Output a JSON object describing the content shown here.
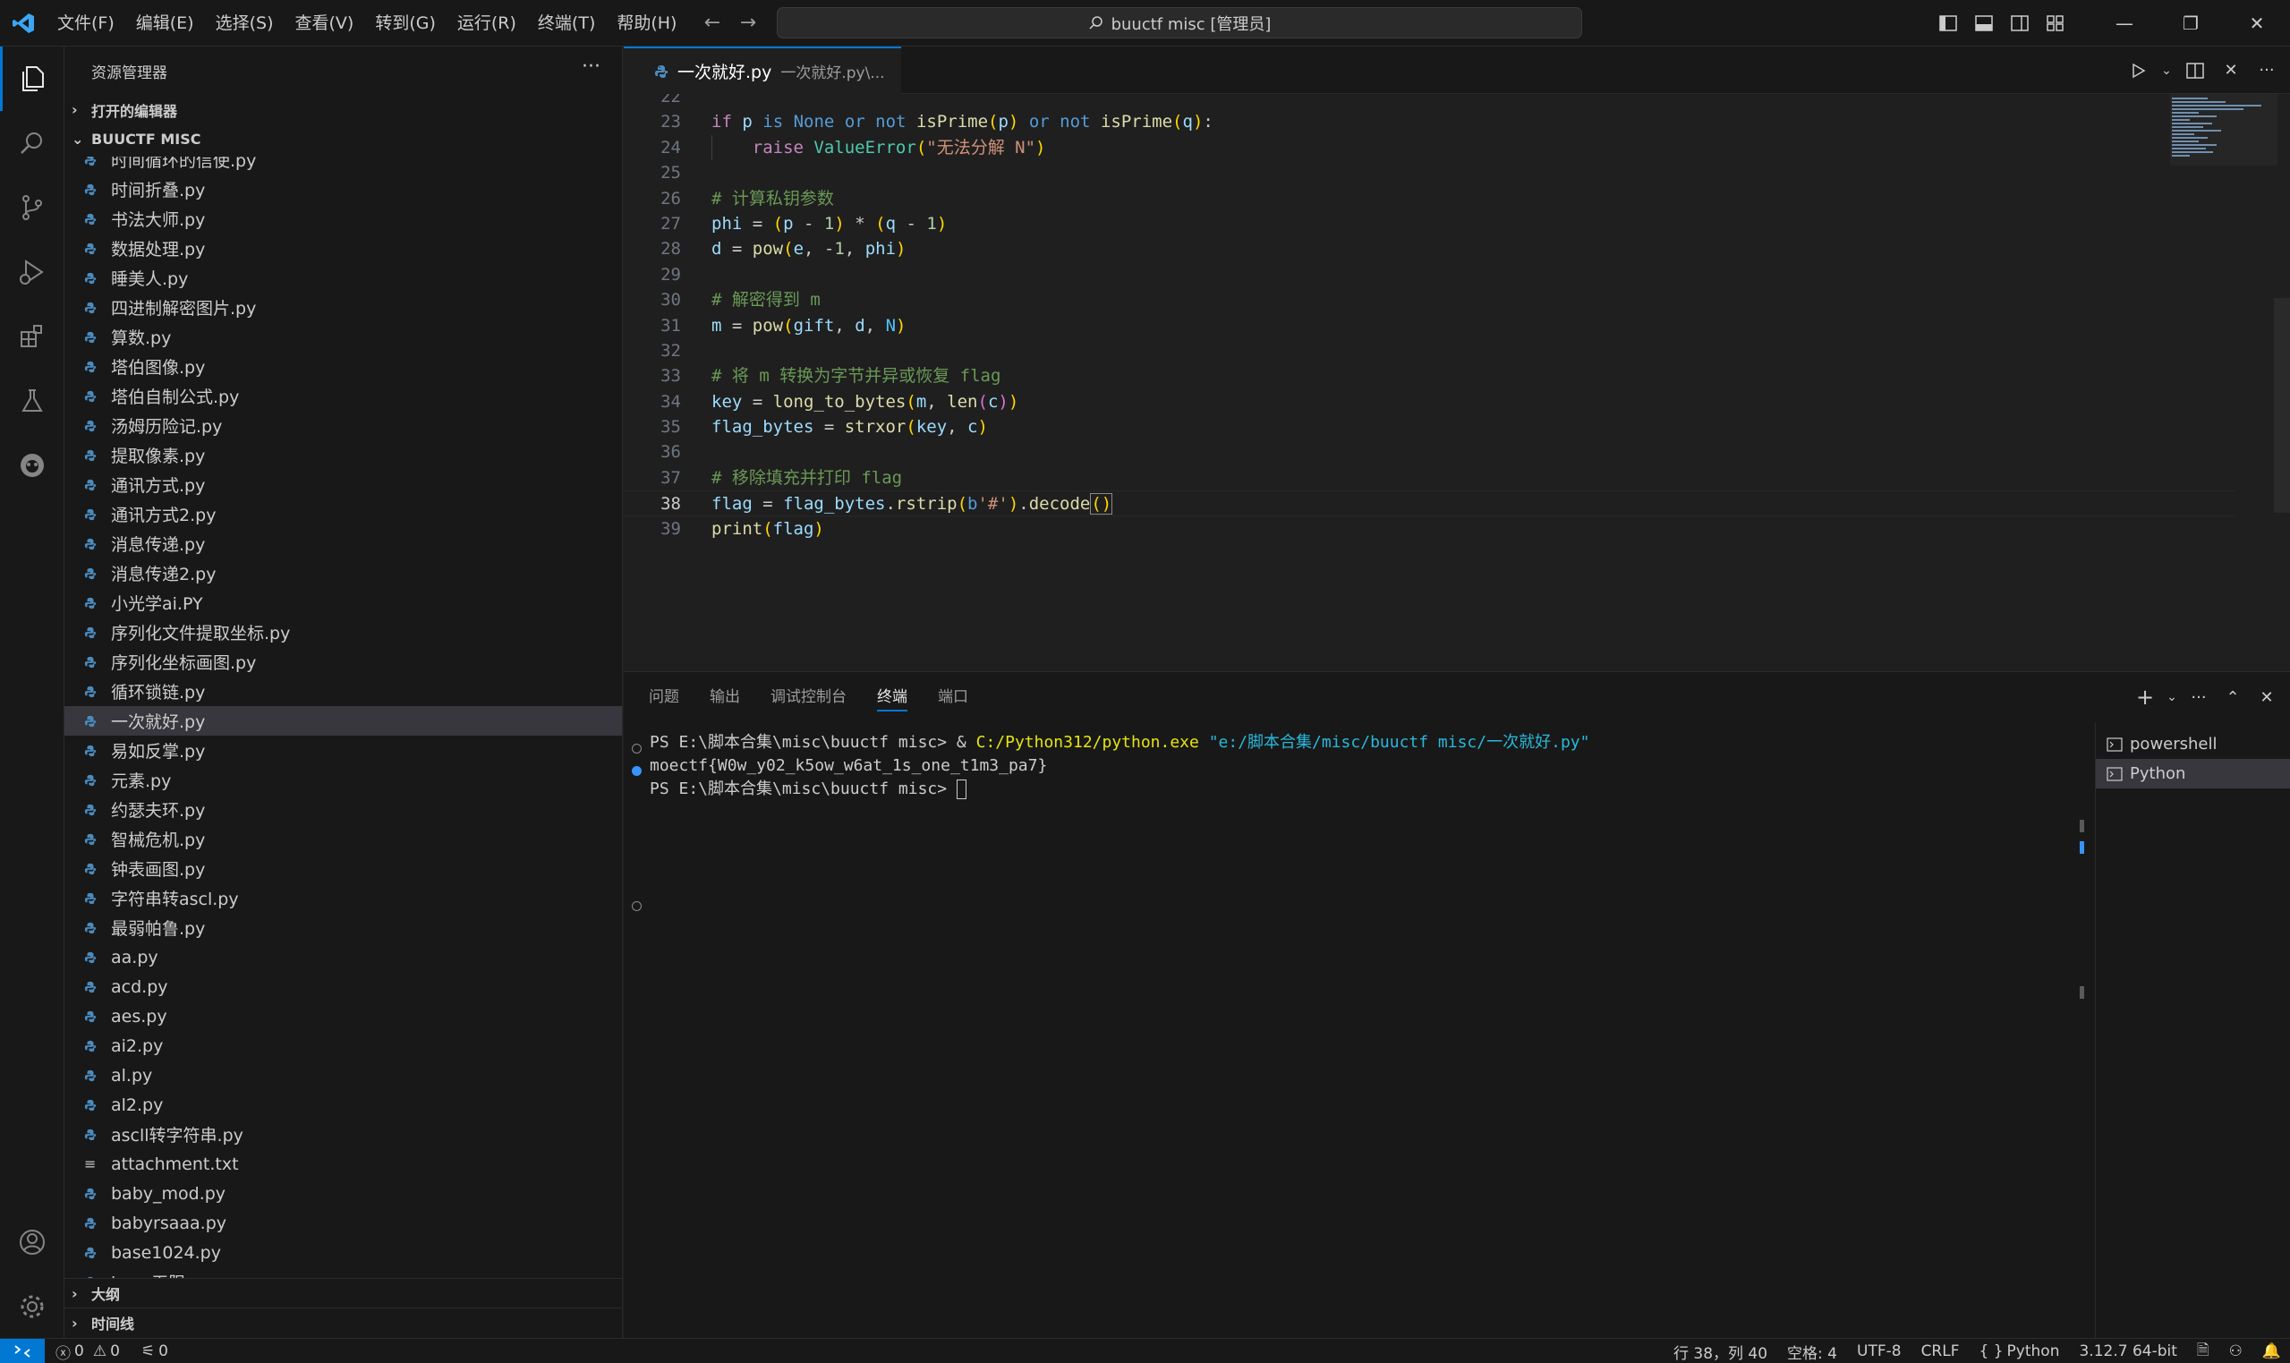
{
  "menu": [
    "文件(F)",
    "编辑(E)",
    "选择(S)",
    "查看(V)",
    "转到(G)",
    "运行(R)",
    "终端(T)",
    "帮助(H)"
  ],
  "command_center": "buuctf misc [管理员]",
  "sidebar": {
    "title": "资源管理器",
    "open_editors": "打开的编辑器",
    "folder": "BUUCTF MISC",
    "files": [
      {
        "name": "时间循环的信使.py",
        "type": "py"
      },
      {
        "name": "时间折叠.py",
        "type": "py"
      },
      {
        "name": "书法大师.py",
        "type": "py"
      },
      {
        "name": "数据处理.py",
        "type": "py"
      },
      {
        "name": "睡美人.py",
        "type": "py"
      },
      {
        "name": "四进制解密图片.py",
        "type": "py"
      },
      {
        "name": "算数.py",
        "type": "py"
      },
      {
        "name": "塔伯图像.py",
        "type": "py"
      },
      {
        "name": "塔伯自制公式.py",
        "type": "py"
      },
      {
        "name": "汤姆历险记.py",
        "type": "py"
      },
      {
        "name": "提取像素.py",
        "type": "py"
      },
      {
        "name": "通讯方式.py",
        "type": "py"
      },
      {
        "name": "通讯方式2.py",
        "type": "py"
      },
      {
        "name": "消息传递.py",
        "type": "py"
      },
      {
        "name": "消息传递2.py",
        "type": "py"
      },
      {
        "name": "小光学ai.PY",
        "type": "py"
      },
      {
        "name": "序列化文件提取坐标.py",
        "type": "py"
      },
      {
        "name": "序列化坐标画图.py",
        "type": "py"
      },
      {
        "name": "循环锁链.py",
        "type": "py"
      },
      {
        "name": "一次就好.py",
        "type": "py",
        "selected": true
      },
      {
        "name": "易如反掌.py",
        "type": "py"
      },
      {
        "name": "元素.py",
        "type": "py"
      },
      {
        "name": "约瑟夫环.py",
        "type": "py"
      },
      {
        "name": "智械危机.py",
        "type": "py"
      },
      {
        "name": "钟表画图.py",
        "type": "py"
      },
      {
        "name": "字符串转ascl.py",
        "type": "py"
      },
      {
        "name": "最弱帕鲁.py",
        "type": "py"
      },
      {
        "name": "aa.py",
        "type": "py"
      },
      {
        "name": "acd.py",
        "type": "py"
      },
      {
        "name": "aes.py",
        "type": "py"
      },
      {
        "name": "ai2.py",
        "type": "py"
      },
      {
        "name": "al.py",
        "type": "py"
      },
      {
        "name": "al2.py",
        "type": "py"
      },
      {
        "name": "ascll转字符串.py",
        "type": "py"
      },
      {
        "name": "attachment.txt",
        "type": "txt"
      },
      {
        "name": "baby_mod.py",
        "type": "py"
      },
      {
        "name": "babyrsaaa.py",
        "type": "py"
      },
      {
        "name": "base1024.py",
        "type": "py"
      },
      {
        "name": "base无限.py",
        "type": "py"
      }
    ],
    "outline": "大纲",
    "timeline": "时间线"
  },
  "tab": {
    "name": "一次就好.py",
    "description": "一次就好.py\\..."
  },
  "editor": {
    "first_partial_line": "22",
    "current_line": "38"
  },
  "panel": {
    "tabs": [
      "问题",
      "输出",
      "调试控制台",
      "终端",
      "端口"
    ],
    "active_tab": "终端",
    "terminal": {
      "line1_prompt": "PS E:\\脚本合集\\misc\\buuctf misc> & ",
      "line1_exe": "C:/Python312/python.exe",
      "line1_arg": " \"e:/脚本合集/misc/buuctf misc/一次就好.py\"",
      "line2": "moectf{W0w_y02_k5ow_w6at_1s_one_t1m3_pa7}",
      "line3": "PS E:\\脚本合集\\misc\\buuctf misc> "
    },
    "terminals": [
      "powershell",
      "Python"
    ]
  },
  "status": {
    "errors": "0",
    "warnings": "0",
    "ports": "0",
    "position": "行 38，列 40",
    "spaces": "空格: 4",
    "encoding": "UTF-8",
    "eol": "CRLF",
    "language": "Python",
    "interpreter": "3.12.7 64-bit"
  },
  "colors": {
    "accent": "#0078d4",
    "background": "#1f1f1f",
    "sidebar": "#181818"
  }
}
